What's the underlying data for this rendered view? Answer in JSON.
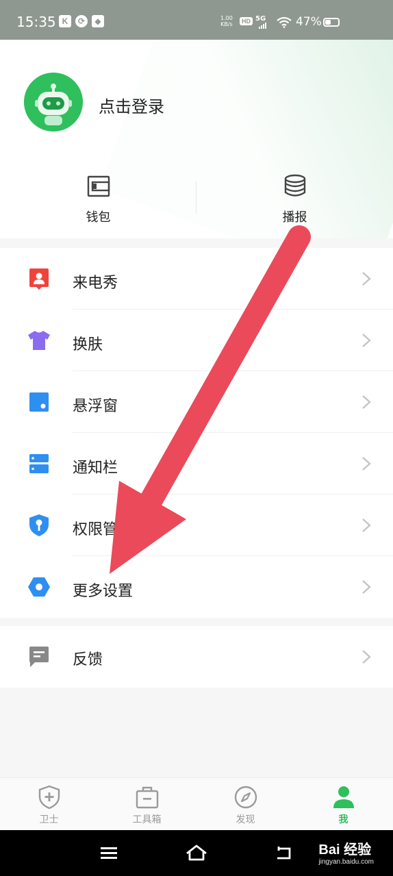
{
  "status_bar": {
    "time": "15:35",
    "net_speed_value": "1.00",
    "net_speed_unit": "KB/s",
    "hd": "HD",
    "network": "5G",
    "battery": "47%",
    "battery_level": 0.47
  },
  "profile": {
    "login_label": "点击登录"
  },
  "quick_actions": [
    {
      "label": "钱包",
      "icon": "wallet-icon"
    },
    {
      "label": "播报",
      "icon": "database-stack-icon"
    }
  ],
  "menu": [
    {
      "label": "来电秀",
      "icon": "caller-show-icon",
      "color": "#f0433c"
    },
    {
      "label": "换肤",
      "icon": "tshirt-icon",
      "color": "#8b6cf0"
    },
    {
      "label": "悬浮窗",
      "icon": "floating-window-icon",
      "color": "#2f8ff0"
    },
    {
      "label": "通知栏",
      "icon": "notification-bar-icon",
      "color": "#2f8ff0"
    },
    {
      "label": "权限管",
      "icon": "shield-key-icon",
      "color": "#2f8ff0"
    },
    {
      "label": "更多设置",
      "icon": "hexagon-settings-icon",
      "color": "#2f8ff0"
    }
  ],
  "menu_secondary": [
    {
      "label": "反馈",
      "icon": "feedback-icon",
      "color": "#888888"
    }
  ],
  "tab_bar": [
    {
      "label": "卫士",
      "icon": "shield-plus-icon",
      "active": false
    },
    {
      "label": "工具箱",
      "icon": "toolbox-icon",
      "active": false
    },
    {
      "label": "发现",
      "icon": "compass-icon",
      "active": false
    },
    {
      "label": "我",
      "icon": "person-icon",
      "active": true
    }
  ],
  "watermark": {
    "brand": "Bai 经验",
    "url": "jingyan.baidu.com"
  },
  "colors": {
    "accent": "#2fbf5d",
    "arrow": "#ea4a5a"
  }
}
